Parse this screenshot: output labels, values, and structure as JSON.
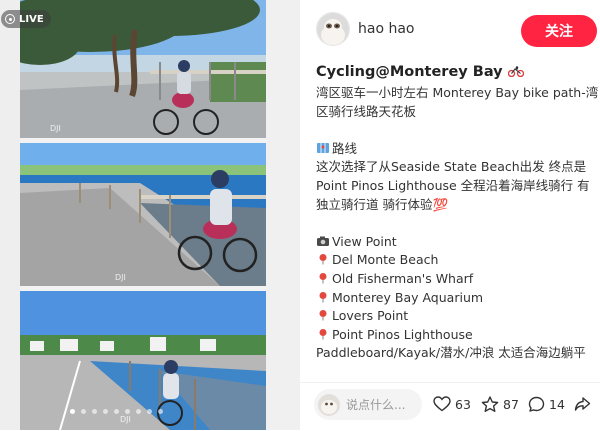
{
  "media": {
    "live_label": "LIVE",
    "carousel_dots": 9,
    "active_dot": 0,
    "watermarks": [
      "DJI",
      "DJI",
      "DJI"
    ]
  },
  "author": {
    "name": "hao hao"
  },
  "follow_label": "关注",
  "note": {
    "title": "Cycling@Monterey Bay",
    "lines": [
      {
        "emoji": "",
        "text": "湾区驱车一小时左右 Monterey Bay bike path-湾"
      },
      {
        "emoji": "",
        "text": "区骑行线路天花板"
      },
      {
        "emoji": "",
        "text": ""
      },
      {
        "emoji": "map",
        "text": "路线"
      },
      {
        "emoji": "",
        "text": "这次选择了从Seaside State Beach出发 终点是"
      },
      {
        "emoji": "",
        "text": "Point Pinos Lighthouse 全程沿着海岸线骑行 有"
      },
      {
        "emoji": "",
        "text": "独立骑行道 骑行体验💯"
      },
      {
        "emoji": "",
        "text": ""
      },
      {
        "emoji": "camera",
        "text": "View Point"
      },
      {
        "emoji": "pin",
        "text": "Del Monte Beach"
      },
      {
        "emoji": "pin",
        "text": "Old Fisherman's Wharf"
      },
      {
        "emoji": "pin",
        "text": "Monterey Bay Aquarium"
      },
      {
        "emoji": "pin",
        "text": "Lovers Point"
      },
      {
        "emoji": "pin",
        "text": "Point Pinos Lighthouse"
      },
      {
        "emoji": "",
        "text": "Paddleboard/Kayak/潜水/冲浪 太适合海边躺平"
      }
    ]
  },
  "comment_placeholder": "说点什么...",
  "stats": {
    "likes": "63",
    "stars": "87",
    "comments": "14"
  },
  "colors": {
    "accent": "#ff2442",
    "text": "#333333",
    "placeholder": "#999999"
  }
}
